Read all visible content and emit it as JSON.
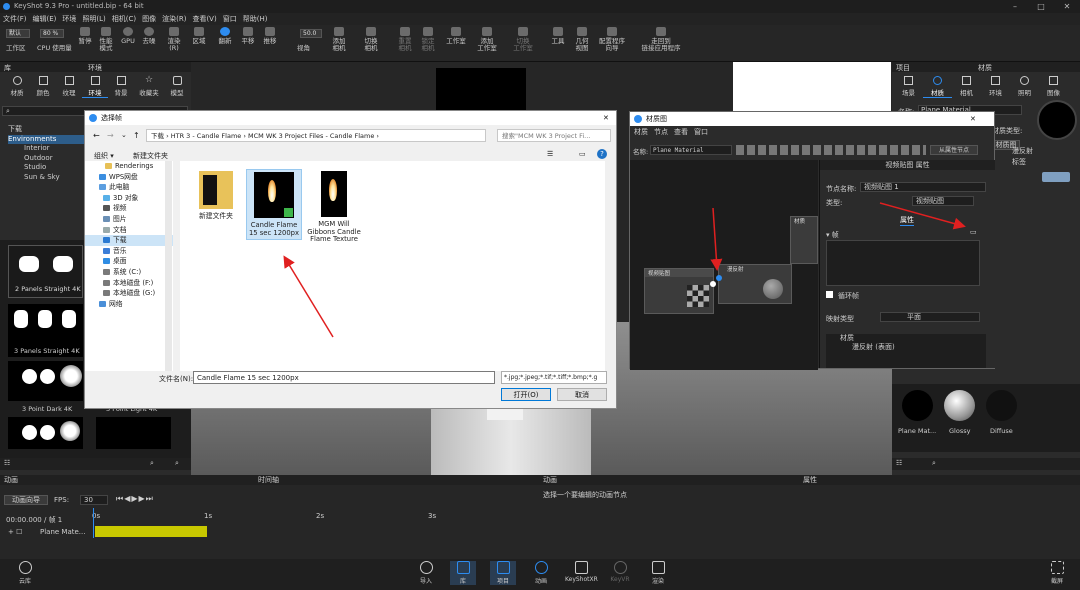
{
  "window": {
    "title": "KeyShot 9.3 Pro - untitled.bip - 64 bit",
    "controls": [
      "–",
      "□",
      "✕"
    ]
  },
  "menu": [
    "文件(F)",
    "编辑(E)",
    "环境",
    "照明(L)",
    "相机(C)",
    "图像",
    "渲染(R)",
    "查看(V)",
    "窗口",
    "帮助(H)"
  ],
  "toolbar": {
    "workspace_select": "默认",
    "zoom_select": "80 %",
    "left_tools": [
      "工作区",
      "CPU 使用量",
      "暂停",
      "性能模式",
      "GPU",
      "去噪",
      "渲染\n(R)",
      "区域"
    ],
    "mid_tools": [
      "翻新",
      "平移",
      "推移"
    ],
    "fov_value": "50.0",
    "view_label": "视角",
    "right_tools": [
      "添加\n相机",
      "切换\n相机",
      "重置\n相机",
      "锁定\n相机",
      "工作室",
      "添加\n工作室",
      "切换\n工作室",
      "工具",
      "几何\n视图",
      "配置程序\n向导",
      "走回到\n链接应用程序"
    ]
  },
  "left_panel": {
    "title": "库",
    "sub_title": "环境",
    "tabs": [
      "材质",
      "颜色",
      "纹理",
      "环境",
      "背景",
      "收藏夹",
      "模型"
    ],
    "tree": [
      "下载",
      "Environments",
      "Interior",
      "Outdoor",
      "Studio",
      "Sun & Sky"
    ],
    "thumbs": [
      "2 Panels Straight 4K",
      "3 Panels Straight 4K",
      "3 Point Dark 4K",
      "3 Point Light 4K"
    ]
  },
  "dialog": {
    "title": "选择帧",
    "path": [
      "下载",
      "HTR 3 - Candle Flame",
      "MCM WK 3 Project Files - Candle Flame"
    ],
    "search_placeholder": "搜索\"MCM WK 3 Project Fi...",
    "organize": "组织 ▾",
    "new_folder": "新建文件夹",
    "nav": [
      "Renderings",
      "WPS网盘",
      "此电脑",
      "3D 对象",
      "视频",
      "图片",
      "文档",
      "下载",
      "音乐",
      "桌面",
      "系统 (C:)",
      "本地磁盘 (F:)",
      "本地磁盘 (G:)",
      "网络"
    ],
    "files": [
      "新建文件夹",
      "Candle Flame 15 sec 1200px",
      "MGM Will Gibbons Candle Flame Texture"
    ],
    "filename_label": "文件名(N):",
    "filename_value": "Candle Flame 15 sec 1200px",
    "filter": "*.jpg;*.jpeg;*.tif;*.tiff;*.bmp;*.g",
    "open_button": "打开(O)",
    "cancel_button": "取消"
  },
  "material_graph": {
    "title": "材质图",
    "menu": [
      "材质",
      "节点",
      "查看",
      "窗口"
    ],
    "name_label": "名称:",
    "name_value": "Plane Material",
    "view_nodes": "从属性节点",
    "node_video": "视频贴图",
    "node_diffuse": "漫反射",
    "node_material": "材质",
    "props_title": "视频贴图  属性",
    "node_name_label": "节点名称:",
    "node_name_value": "视频贴图 1",
    "type_label": "类型:",
    "type_value": "视频贴图",
    "tab_props": "属性",
    "frame_label": "▾ 帧",
    "loop_label": "循环帧",
    "mapping_label": "映射类型",
    "mapping_value": "平面",
    "tree_root": "材质",
    "tree_child": "漫反射 (表面)"
  },
  "right_panel": {
    "title": "项目",
    "sub_title": "材质",
    "tabs": [
      "场景",
      "材质",
      "相机",
      "环境",
      "照明",
      "图像"
    ],
    "name_label": "名称:",
    "name_value": "Plane Material",
    "type_label": "材质类型:",
    "btn_graph": "材质图",
    "diffuse": "漫反射",
    "label": "标签",
    "balls": [
      "Plane Mat...",
      "Glossy",
      "Diffuse"
    ]
  },
  "animation": {
    "title": "动画",
    "timeline": "时间轴",
    "wizard": "动画向导",
    "fps_label": "FPS:",
    "fps_value": "30",
    "time": "00:00.000 / 帧 1",
    "ticks": [
      "0s",
      "1s",
      "2s",
      "3s"
    ],
    "track": "Plane Mate..."
  },
  "properties": {
    "title": "动画",
    "sub": "属性",
    "hint": "选择一个要编辑的动画节点"
  },
  "bottom": {
    "left": "云库",
    "items": [
      "导入",
      "库",
      "项目",
      "动画",
      "KeyShotXR",
      "KeyVR",
      "渲染"
    ],
    "right": "截屏"
  },
  "colors": {
    "accent": "#2d8cf0",
    "track": "#c8c800",
    "arrow": "#e02020"
  }
}
